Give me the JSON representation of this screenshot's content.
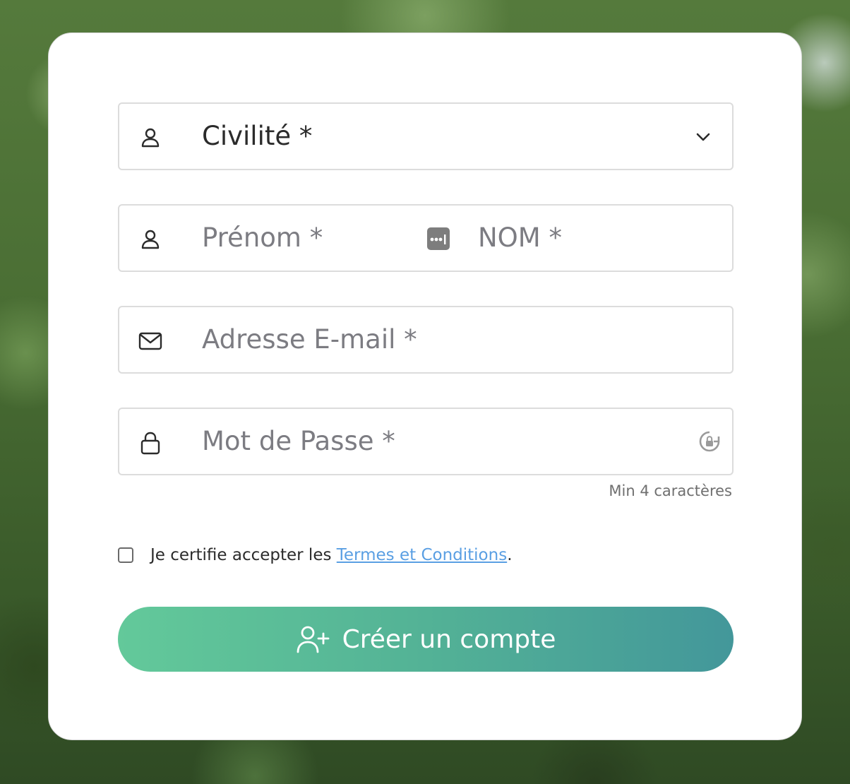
{
  "form": {
    "civility": {
      "label": "Civilité *",
      "icon": "user-icon"
    },
    "first_name": {
      "placeholder": "Prénom *",
      "icon": "user-icon"
    },
    "last_name": {
      "placeholder": "NOM *",
      "icon": "password-dots-icon"
    },
    "email": {
      "placeholder": "Adresse E-mail *",
      "icon": "mail-icon"
    },
    "password": {
      "placeholder": "Mot de Passe *",
      "icon": "lock-icon",
      "hint": "Min 4 caractères"
    },
    "terms": {
      "prefix": "Je certifie accepter les ",
      "link": "Termes et Conditions",
      "suffix": ".",
      "checked": false
    },
    "submit": {
      "label": "Créer un compte",
      "icon": "user-plus-icon"
    }
  },
  "colors": {
    "button_gradient_start": "#63c99a",
    "button_gradient_end": "#43979a",
    "link": "#5a9fe3",
    "placeholder": "#7c7c82"
  }
}
